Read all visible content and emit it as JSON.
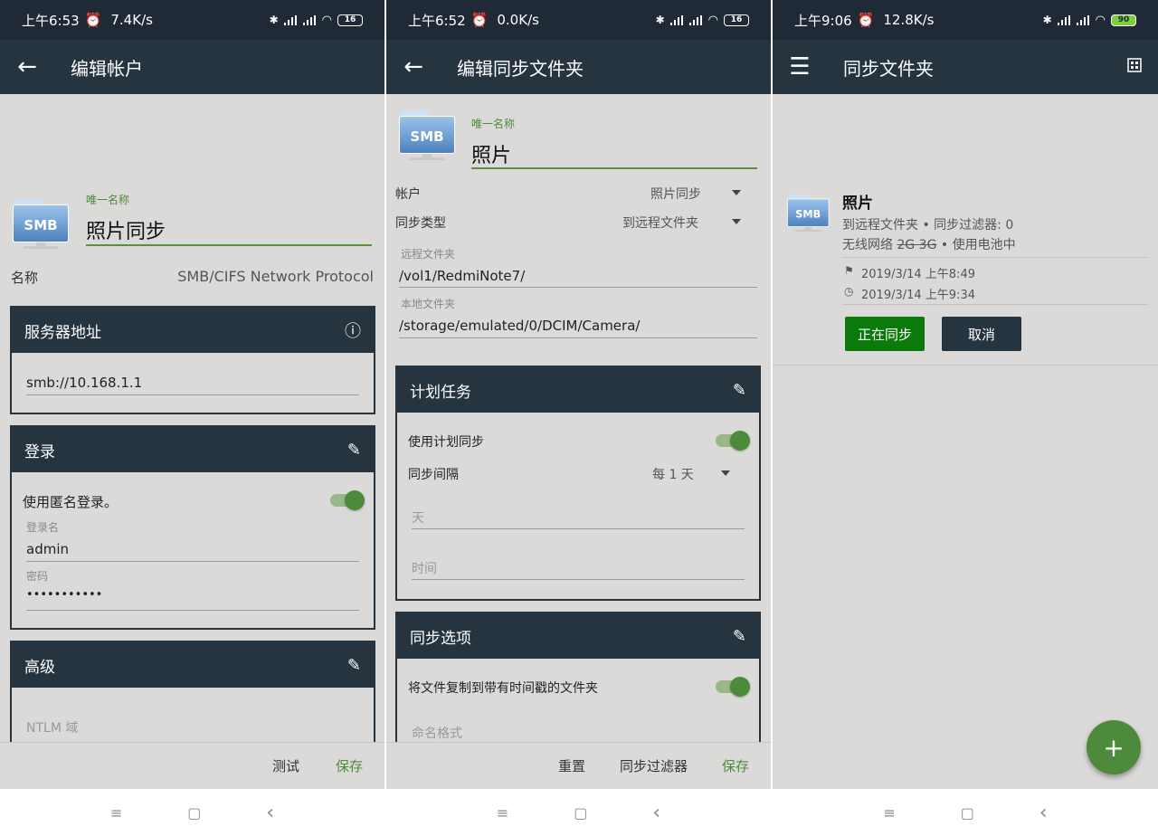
{
  "panel1": {
    "status": {
      "time": "上午6:53",
      "speed": "7.4K/s",
      "battery": "16"
    },
    "toolbar_title": "编辑帐户",
    "unique_label": "唯一名称",
    "unique_name": "照片同步",
    "icon_text": "SMB",
    "name_label": "名称",
    "name_value": "SMB/CIFS Network Protocol",
    "server_card": {
      "title": "服务器地址",
      "value": "smb://10.168.1.1"
    },
    "login_card": {
      "title": "登录",
      "anonymous_label": "使用匿名登录。",
      "username_hint": "登录名",
      "username_value": "admin",
      "password_hint": "密码",
      "password_value": "•••••••••••"
    },
    "advanced_card": {
      "title": "高级",
      "ntlm_placeholder": "NTLM 域"
    },
    "actions": {
      "test": "测试",
      "save": "保存"
    }
  },
  "panel2": {
    "status": {
      "time": "上午6:52",
      "speed": "0.0K/s",
      "battery": "16"
    },
    "toolbar_title": "编辑同步文件夹",
    "unique_label": "唯一名称",
    "unique_name": "照片",
    "icon_text": "SMB",
    "account_label": "帐户",
    "account_value": "照片同步",
    "sync_type_label": "同步类型",
    "sync_type_value": "到远程文件夹",
    "remote_hint": "远程文件夹",
    "remote_value": "/vol1/RedmiNote7/",
    "local_hint": "本地文件夹",
    "local_value": "/storage/emulated/0/DCIM/Camera/",
    "schedule_card": {
      "title": "计划任务",
      "use_schedule": "使用计划同步",
      "interval_label": "同步间隔",
      "interval_value": "每 1 天",
      "day_placeholder": "天",
      "time_placeholder": "时间"
    },
    "options_card": {
      "title": "同步选项",
      "copy_label": "将文件复制到带有时间戳的文件夹",
      "naming_placeholder": "命名格式"
    },
    "actions": {
      "reset": "重置",
      "filters": "同步过滤器",
      "save": "保存"
    }
  },
  "panel3": {
    "status": {
      "time": "上午9:06",
      "speed": "12.8K/s",
      "battery": "90"
    },
    "toolbar_title": "同步文件夹",
    "item": {
      "icon_text": "SMB",
      "name": "照片",
      "line1": "到远程文件夹 • 同步过滤器: 0",
      "line2_prefix": "无线网络",
      "line2_strike": "2G 3G",
      "line2_suffix": "• 使用电池中",
      "date1": "2019/3/14 上午8:49",
      "date2": "2019/3/14 上午9:34",
      "sync_button": "正在同步",
      "cancel_button": "取消"
    },
    "fab": "+"
  },
  "nav": {
    "menu": "≡",
    "home": "▢",
    "back": "‹"
  },
  "colors": {
    "accent": "#4e8a3c",
    "toolbar": "#263440",
    "background": "#dcd9d9",
    "sync_button": "#0a7a0a"
  }
}
